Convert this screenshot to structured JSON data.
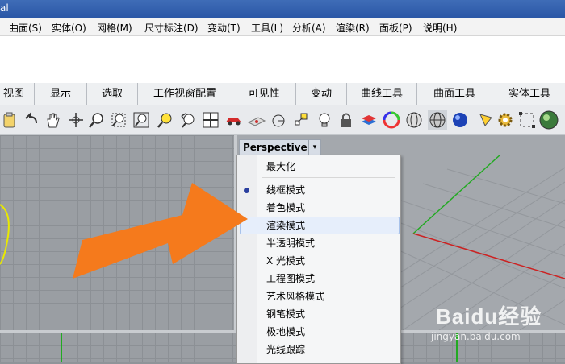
{
  "title": {
    "partial": "al"
  },
  "menubar": [
    "曲面(S)",
    "实体(O)",
    "网格(M)",
    "尺寸标注(D)",
    "变动(T)",
    "工具(L)",
    "分析(A)",
    "渲染(R)",
    "面板(P)",
    "说明(H)"
  ],
  "tabs": [
    "视图",
    "显示",
    "选取",
    "工作视窗配置",
    "可见性",
    "变动",
    "曲线工具",
    "曲面工具",
    "实体工具"
  ],
  "toolbar_icons": [
    "clipboard-icon",
    "undo-icon",
    "pan-hand-icon",
    "rotate-view-icon",
    "zoom-icon",
    "zoom-window-icon",
    "zoom-extents-icon",
    "zoom-selected-icon",
    "undo-view-icon",
    "four-viewports-icon",
    "car-icon",
    "named-view-icon",
    "set-cplane-icon",
    "snap-points-icon",
    "light-bulb-icon",
    "lock-icon",
    "layer-icon",
    "color-wheel-icon",
    "wireframe-sphere-icon",
    "shaded-sphere-icon",
    "rendered-sphere-icon",
    "spotlight-icon",
    "settings-gear-icon",
    "cage-edit-icon",
    "render-icon"
  ],
  "viewport": {
    "label": "Perspective",
    "dropdown_symbol": "▾"
  },
  "menu": {
    "items": [
      "最大化",
      "线框模式",
      "着色模式",
      "渲染模式",
      "半透明模式",
      "X 光模式",
      "工程图模式",
      "艺术风格模式",
      "钢笔模式",
      "极地模式",
      "光线跟踪"
    ],
    "checked": "线框模式",
    "highlighted": "渲染模式"
  },
  "watermark": {
    "brand": "Baidu",
    "brand_suffix": "经验",
    "url": "jingyan.baidu.com"
  },
  "colors": {
    "arrow": "#f57a1c",
    "axis_x": "#cc2222",
    "axis_y": "#22aa22",
    "circle": "#e8e800"
  }
}
